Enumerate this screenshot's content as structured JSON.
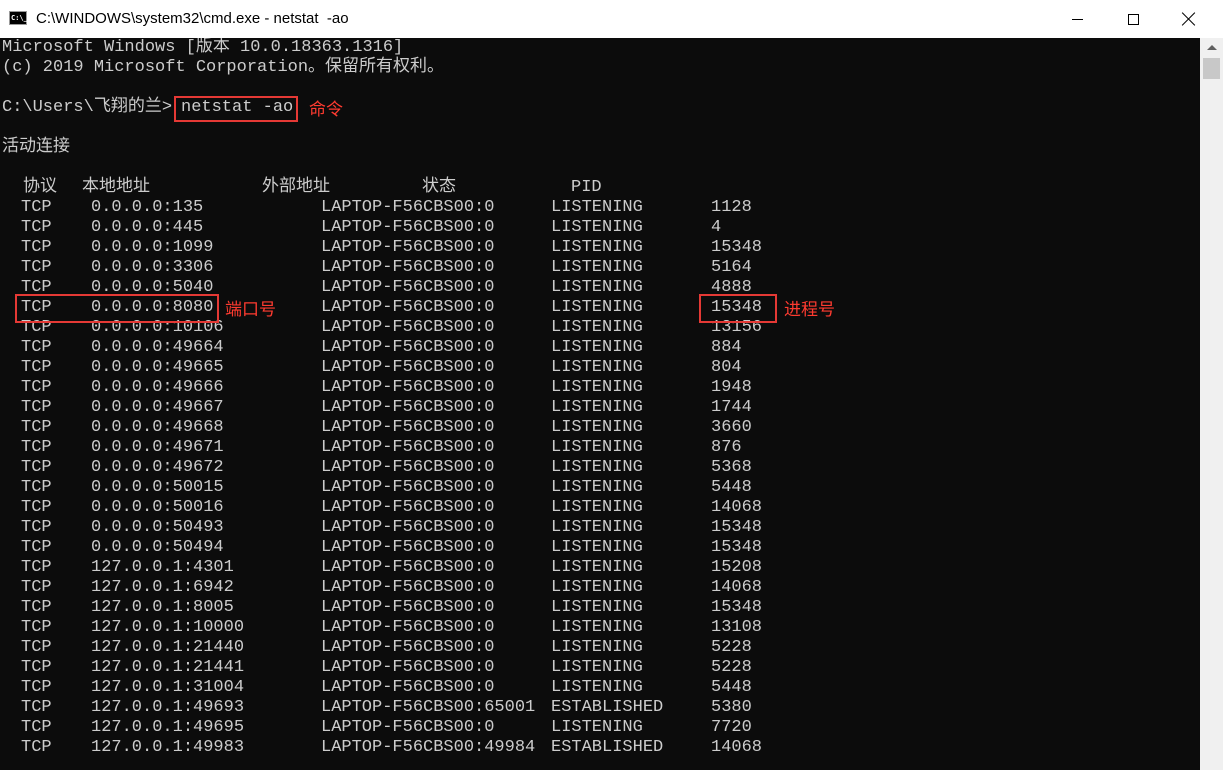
{
  "window": {
    "title": "C:\\WINDOWS\\system32\\cmd.exe - netstat  -ao",
    "icon_label": "C:\\_",
    "icon": "cmd-app-icon",
    "controls": [
      "minimize-icon",
      "maximize-icon",
      "close-icon"
    ]
  },
  "console": {
    "header_line1": "Microsoft Windows [版本 10.0.18363.1316]",
    "header_line2": "(c) 2019 Microsoft Corporation。保留所有权利。",
    "prompt": "C:\\Users\\飞翔的兰>",
    "command": "netstat -ao",
    "section_title": "活动连接",
    "columns": [
      "协议",
      "本地地址",
      "外部地址",
      "状态",
      "PID"
    ],
    "rows": [
      [
        "TCP",
        "0.0.0.0:135",
        "LAPTOP-F56CBS00:0",
        "LISTENING",
        "1128"
      ],
      [
        "TCP",
        "0.0.0.0:445",
        "LAPTOP-F56CBS00:0",
        "LISTENING",
        "4"
      ],
      [
        "TCP",
        "0.0.0.0:1099",
        "LAPTOP-F56CBS00:0",
        "LISTENING",
        "15348"
      ],
      [
        "TCP",
        "0.0.0.0:3306",
        "LAPTOP-F56CBS00:0",
        "LISTENING",
        "5164"
      ],
      [
        "TCP",
        "0.0.0.0:5040",
        "LAPTOP-F56CBS00:0",
        "LISTENING",
        "4888"
      ],
      [
        "TCP",
        "0.0.0.0:8080",
        "LAPTOP-F56CBS00:0",
        "LISTENING",
        "15348"
      ],
      [
        "TCP",
        "0.0.0.0:10106",
        "LAPTOP-F56CBS00:0",
        "LISTENING",
        "13156"
      ],
      [
        "TCP",
        "0.0.0.0:49664",
        "LAPTOP-F56CBS00:0",
        "LISTENING",
        "884"
      ],
      [
        "TCP",
        "0.0.0.0:49665",
        "LAPTOP-F56CBS00:0",
        "LISTENING",
        "804"
      ],
      [
        "TCP",
        "0.0.0.0:49666",
        "LAPTOP-F56CBS00:0",
        "LISTENING",
        "1948"
      ],
      [
        "TCP",
        "0.0.0.0:49667",
        "LAPTOP-F56CBS00:0",
        "LISTENING",
        "1744"
      ],
      [
        "TCP",
        "0.0.0.0:49668",
        "LAPTOP-F56CBS00:0",
        "LISTENING",
        "3660"
      ],
      [
        "TCP",
        "0.0.0.0:49671",
        "LAPTOP-F56CBS00:0",
        "LISTENING",
        "876"
      ],
      [
        "TCP",
        "0.0.0.0:49672",
        "LAPTOP-F56CBS00:0",
        "LISTENING",
        "5368"
      ],
      [
        "TCP",
        "0.0.0.0:50015",
        "LAPTOP-F56CBS00:0",
        "LISTENING",
        "5448"
      ],
      [
        "TCP",
        "0.0.0.0:50016",
        "LAPTOP-F56CBS00:0",
        "LISTENING",
        "14068"
      ],
      [
        "TCP",
        "0.0.0.0:50493",
        "LAPTOP-F56CBS00:0",
        "LISTENING",
        "15348"
      ],
      [
        "TCP",
        "0.0.0.0:50494",
        "LAPTOP-F56CBS00:0",
        "LISTENING",
        "15348"
      ],
      [
        "TCP",
        "127.0.0.1:4301",
        "LAPTOP-F56CBS00:0",
        "LISTENING",
        "15208"
      ],
      [
        "TCP",
        "127.0.0.1:6942",
        "LAPTOP-F56CBS00:0",
        "LISTENING",
        "14068"
      ],
      [
        "TCP",
        "127.0.0.1:8005",
        "LAPTOP-F56CBS00:0",
        "LISTENING",
        "15348"
      ],
      [
        "TCP",
        "127.0.0.1:10000",
        "LAPTOP-F56CBS00:0",
        "LISTENING",
        "13108"
      ],
      [
        "TCP",
        "127.0.0.1:21440",
        "LAPTOP-F56CBS00:0",
        "LISTENING",
        "5228"
      ],
      [
        "TCP",
        "127.0.0.1:21441",
        "LAPTOP-F56CBS00:0",
        "LISTENING",
        "5228"
      ],
      [
        "TCP",
        "127.0.0.1:31004",
        "LAPTOP-F56CBS00:0",
        "LISTENING",
        "5448"
      ],
      [
        "TCP",
        "127.0.0.1:49693",
        "LAPTOP-F56CBS00:65001",
        "ESTABLISHED",
        "5380"
      ],
      [
        "TCP",
        "127.0.0.1:49695",
        "LAPTOP-F56CBS00:0",
        "LISTENING",
        "7720"
      ],
      [
        "TCP",
        "127.0.0.1:49983",
        "LAPTOP-F56CBS00:49984",
        "ESTABLISHED",
        "14068"
      ]
    ],
    "highlighted_row_index": 5
  },
  "annotations": {
    "command_label": "命令",
    "port_label": "端口号",
    "pid_label": "进程号",
    "color": "#e53935"
  },
  "colors": {
    "console_bg": "#0c0c0c",
    "console_fg": "#cccccc",
    "annotation": "#ff3b30"
  }
}
